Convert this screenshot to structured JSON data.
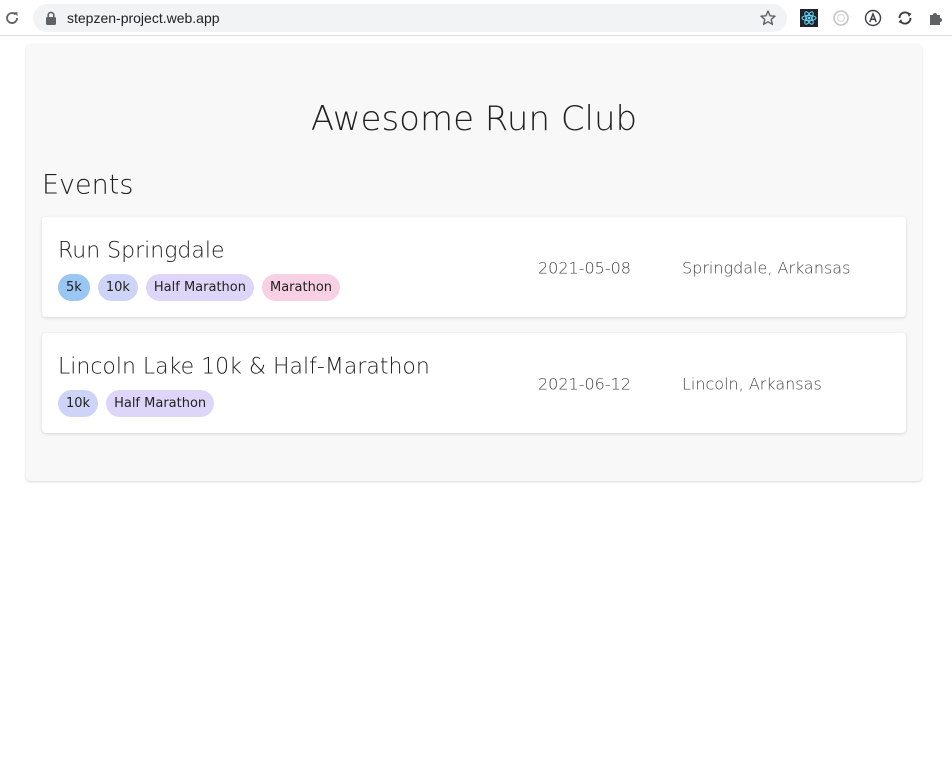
{
  "browser": {
    "url": "stepzen-project.web.app"
  },
  "page": {
    "title": "Awesome Run Club",
    "section_heading": "Events"
  },
  "events": [
    {
      "name": "Run Springdale",
      "date": "2021-05-08",
      "location": "Springdale, Arkansas",
      "tags": [
        "5k",
        "10k",
        "Half Marathon",
        "Marathon"
      ]
    },
    {
      "name": "Lincoln Lake 10k & Half-Marathon",
      "date": "2021-06-12",
      "location": "Lincoln, Arkansas",
      "tags": [
        "10k",
        "Half Marathon"
      ]
    }
  ],
  "tag_colors": {
    "5k": "#99c6f3",
    "10k": "#cdd4f7",
    "Half Marathon": "#ddd6f8",
    "Marathon": "#f7d0e3"
  },
  "icons": {
    "reload": "reload-icon",
    "lock": "lock-icon",
    "star": "star-icon",
    "extensions": [
      "react-devtools-icon",
      "extension-circle-icon",
      "extension-a-icon",
      "extension-sync-icon",
      "puzzle-icon"
    ]
  }
}
